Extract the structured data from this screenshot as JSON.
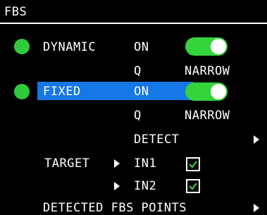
{
  "title": "FBS",
  "dynamic": {
    "label": "DYNAMIC",
    "state": "ON",
    "q_label": "Q",
    "q_value": "NARROW",
    "enabled": true,
    "led_color": "#2ecc3a"
  },
  "fixed": {
    "label": "FIXED",
    "state": "ON",
    "q_label": "Q",
    "q_value": "NARROW",
    "enabled": true,
    "led_color": "#2ecc3a"
  },
  "detect": {
    "label": "DETECT"
  },
  "target": {
    "label": "TARGET",
    "in1_label": "IN1",
    "in1_checked": true,
    "in2_label": "IN2",
    "in2_checked": true
  },
  "detected_points": {
    "label": "DETECTED FBS POINTS"
  },
  "colors": {
    "accent": "#1677e6",
    "toggle_on": "#34d43c",
    "check": "#34d43c"
  }
}
